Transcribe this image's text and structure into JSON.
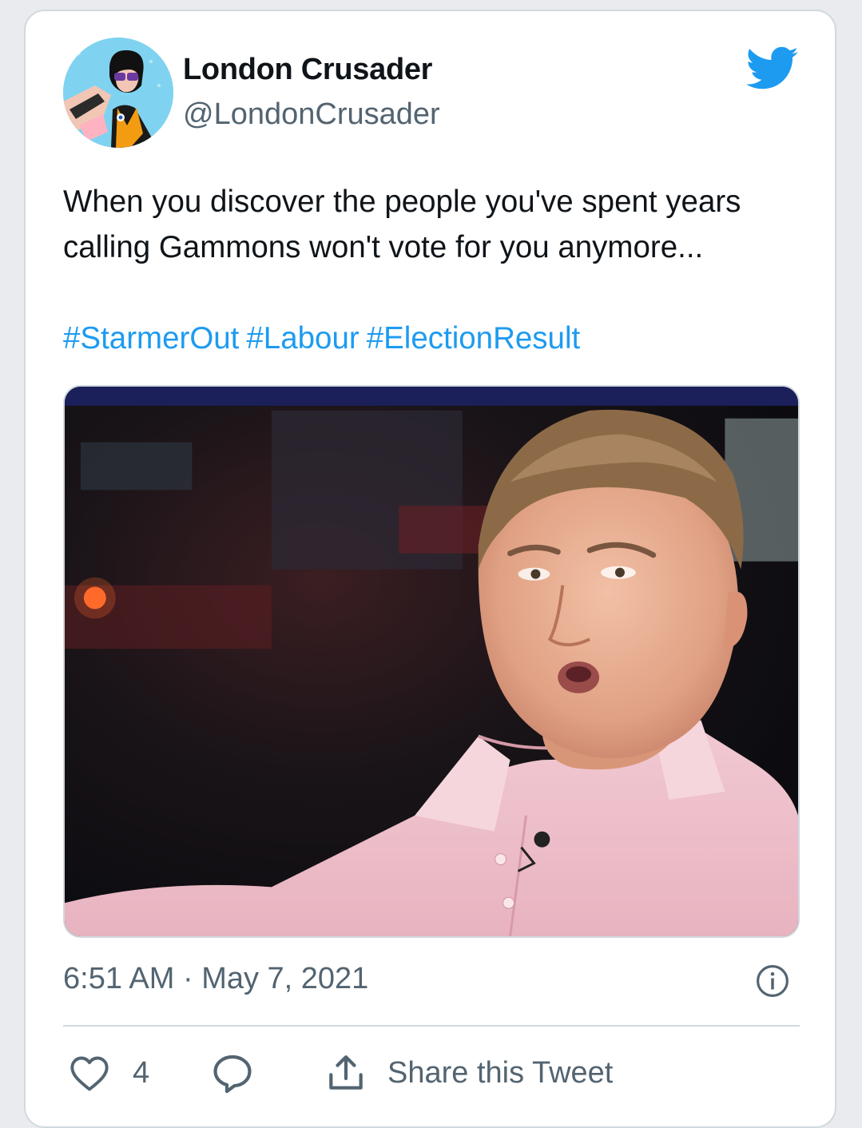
{
  "tweet": {
    "author_name": "London Crusader",
    "author_handle": "@LondonCrusader",
    "text_line1": "When you discover the people you've spent years",
    "text_line2": "calling Gammons won't vote for you anymore...",
    "hashtags": [
      "#StarmerOut",
      "#Labour",
      "#ElectionResult"
    ],
    "timestamp": "6:51 AM · May 7, 2021"
  },
  "actions": {
    "like_count": "4",
    "share_label": "Share this Tweet"
  },
  "icons": {
    "brand": "twitter-bird-icon",
    "info": "info-icon",
    "like": "heart-icon",
    "reply": "reply-bubble-icon",
    "share": "share-upload-icon"
  },
  "colors": {
    "link": "#1d9bf0",
    "text_primary": "#0f1419",
    "text_secondary": "#536471",
    "border": "#cfd9de"
  }
}
